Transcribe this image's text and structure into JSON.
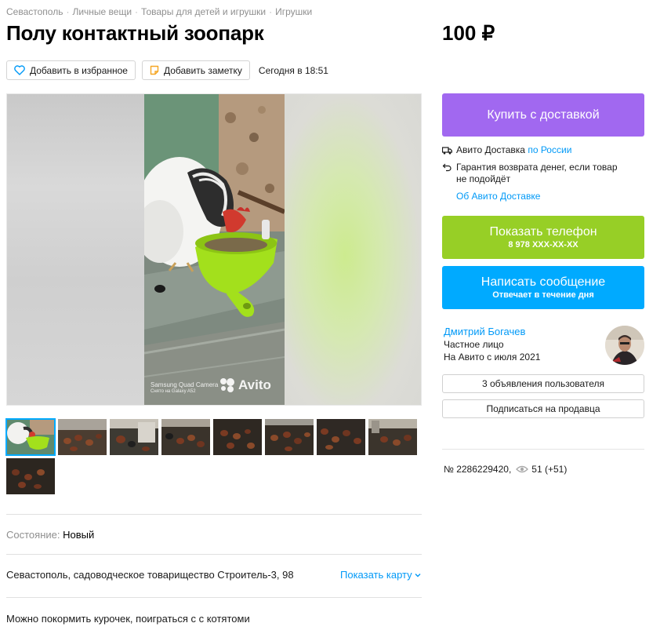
{
  "breadcrumbs": [
    "Севастополь",
    "Личные вещи",
    "Товары для детей и игрушки",
    "Игрушки"
  ],
  "title": "Полу контактный зоопарк",
  "price": "100 ₽",
  "actions": {
    "favorite_label": "Добавить в избранное",
    "note_label": "Добавить заметку",
    "date": "Сегодня в 18:51"
  },
  "gallery": {
    "watermark_line1": "Samsung Quad Camera",
    "watermark_line2": "Снято на Galaxy A52",
    "avito_watermark": "Avito",
    "thumbnails_count": 9
  },
  "condition": {
    "label": "Состояние:",
    "value": "Новый"
  },
  "address": {
    "text": "Севастополь, садоводческое товарищество Строитель-3, 98",
    "map_link": "Показать карту"
  },
  "description": "Можно покормить курочек, поиграться с с котятоми",
  "buy_button": "Купить с доставкой",
  "delivery": {
    "line1_prefix": "Авито Доставка",
    "line1_link": "по России",
    "guarantee_line1": "Гарантия возврата денег, если товар",
    "guarantee_line2": "не подойдёт",
    "about_link": "Об Авито Доставке"
  },
  "phone_button": {
    "label": "Показать телефон",
    "number": "8 978 XXX-XX-XX"
  },
  "message_button": {
    "label": "Написать сообщение",
    "sub": "Отвечает в течение дня"
  },
  "seller": {
    "name": "Дмитрий Богачев",
    "type": "Частное лицо",
    "since": "На Авито с июля 2021",
    "listings_button": "3 объявления пользователя",
    "subscribe_button": "Подписаться на продавца"
  },
  "meta": {
    "id": "№ 2286229420,",
    "views": "51 (+51)"
  },
  "colors": {
    "accent_blue": "#00aaff",
    "buy_purple": "#a168f0",
    "phone_green": "#97cf26"
  }
}
